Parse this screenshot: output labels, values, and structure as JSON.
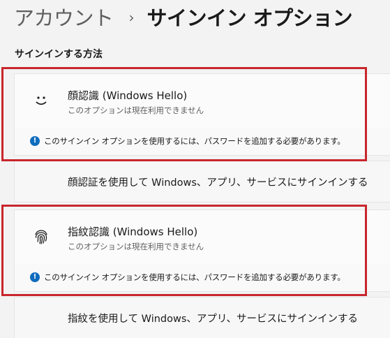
{
  "breadcrumb": {
    "parent": "アカウント",
    "separator": "›",
    "current": "サインイン オプション"
  },
  "section_title": "サインインする方法",
  "options": [
    {
      "title": "顔認識 (Windows Hello)",
      "subtitle": "このオプションは現在利用できません",
      "warning": "このサインイン オプションを使用するには、パスワードを追加する必要があります。",
      "description": "顔認証を使用して Windows、アプリ、サービスにサインインする",
      "icon": "face-smile-icon"
    },
    {
      "title": "指紋認識 (Windows Hello)",
      "subtitle": "このオプションは現在利用できません",
      "warning": "このサインイン オプションを使用するには、パスワードを追加する必要があります。",
      "description": "指紋を使用して Windows、アプリ、サービスにサインインする",
      "icon": "fingerprint-icon"
    }
  ],
  "colors": {
    "accent": "#0f6cbd",
    "highlight": "#c8262c",
    "background": "#f3f3f3"
  }
}
